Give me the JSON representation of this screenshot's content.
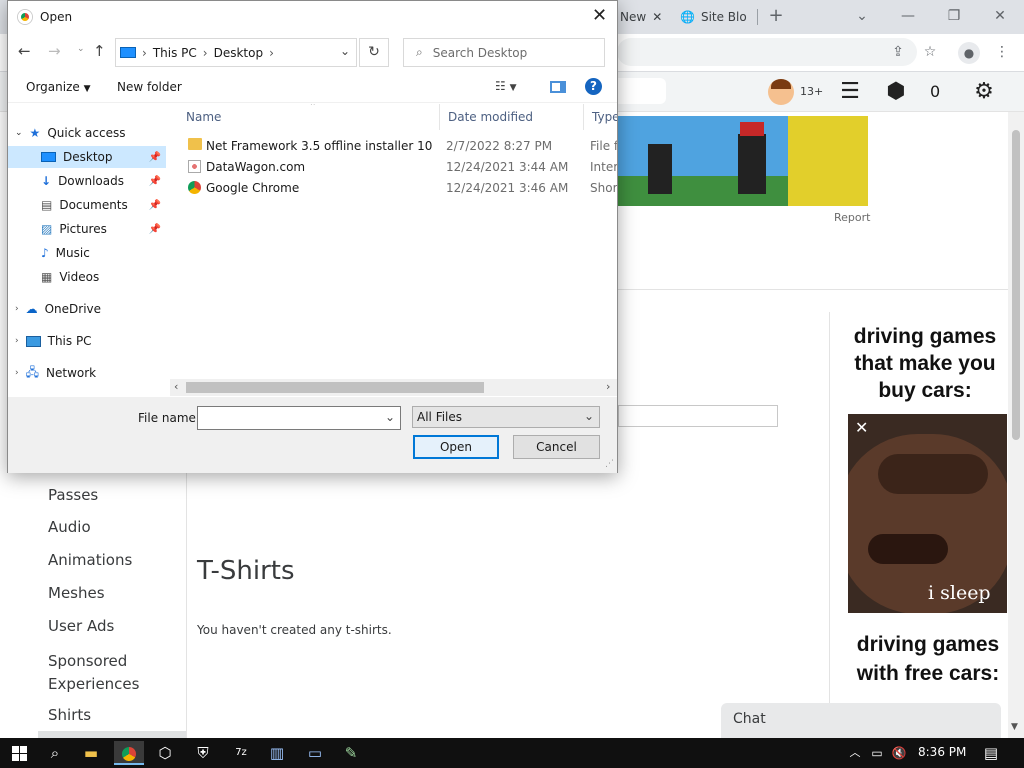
{
  "browser": {
    "tabs": [
      {
        "label": "New"
      },
      {
        "label": "Site Blo"
      }
    ],
    "new_tab_icon": "plus-icon"
  },
  "roblox_header": {
    "robux_count": "0",
    "age_badge": "13+"
  },
  "page": {
    "banner_report": "Report",
    "sidebar_items": [
      "Passes",
      "Audio",
      "Animations",
      "Meshes",
      "User Ads",
      "Sponsored Experiences",
      "Shirts"
    ],
    "section_title": "T-Shirts",
    "empty_message": "You haven't created any t-shirts.",
    "ad": {
      "text_top": "driving games that make you buy cars:",
      "image_caption": "i sleep",
      "text_bottom": "driving games with free cars:"
    },
    "chat_label": "Chat"
  },
  "dialog": {
    "title": "Open",
    "breadcrumb": [
      "This PC",
      "Desktop"
    ],
    "search_placeholder": "Search Desktop",
    "toolbar": {
      "organize": "Organize",
      "new_folder": "New folder"
    },
    "nav": [
      {
        "label": "Quick access",
        "icon": "star-icon",
        "pinned": false,
        "selected": false,
        "level": 0
      },
      {
        "label": "Desktop",
        "icon": "desktop-icon",
        "pinned": true,
        "selected": true,
        "level": 1
      },
      {
        "label": "Downloads",
        "icon": "download-icon",
        "pinned": true,
        "selected": false,
        "level": 1
      },
      {
        "label": "Documents",
        "icon": "document-icon",
        "pinned": true,
        "selected": false,
        "level": 1
      },
      {
        "label": "Pictures",
        "icon": "picture-icon",
        "pinned": true,
        "selected": false,
        "level": 1
      },
      {
        "label": "Music",
        "icon": "music-icon",
        "pinned": false,
        "selected": false,
        "level": 1
      },
      {
        "label": "Videos",
        "icon": "video-icon",
        "pinned": false,
        "selected": false,
        "level": 1
      },
      {
        "label": "OneDrive",
        "icon": "cloud-icon",
        "pinned": false,
        "selected": false,
        "level": 0
      },
      {
        "label": "This PC",
        "icon": "computer-icon",
        "pinned": false,
        "selected": false,
        "level": 0
      },
      {
        "label": "Network",
        "icon": "network-icon",
        "pinned": false,
        "selected": false,
        "level": 0
      }
    ],
    "columns": [
      "Name",
      "Date modified",
      "Type"
    ],
    "files": [
      {
        "name": "Net Framework 3.5 offline installer 10",
        "date": "2/7/2022 8:27 PM",
        "type": "File fo",
        "icon": "folder-icon"
      },
      {
        "name": "DataWagon.com",
        "date": "12/24/2021 3:44 AM",
        "type": "Intern",
        "icon": "internet-shortcut-icon"
      },
      {
        "name": "Google Chrome",
        "date": "12/24/2021 3:46 AM",
        "type": "Short",
        "icon": "chrome-icon"
      }
    ],
    "file_name_label": "File name:",
    "file_name_value": "",
    "file_type": "All Files",
    "open_button": "Open",
    "cancel_button": "Cancel"
  },
  "taskbar": {
    "time": "8:36 PM"
  },
  "colors": {
    "accent": "#0078d7",
    "selection": "#cce8ff",
    "taskbar": "#101010"
  }
}
